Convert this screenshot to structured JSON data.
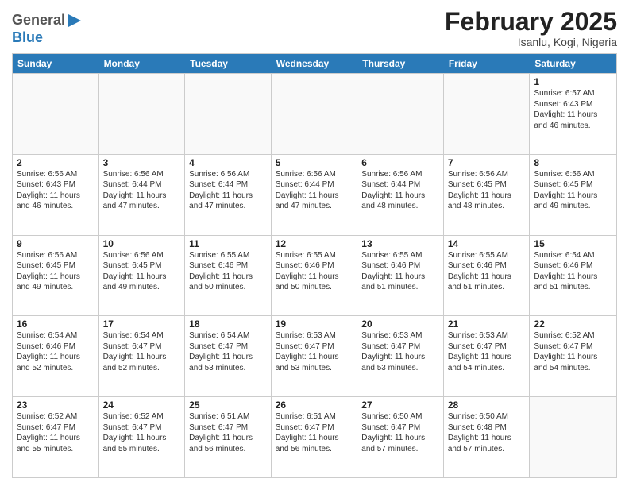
{
  "header": {
    "logo": {
      "line1": "General",
      "line2": "Blue",
      "icon": "▶"
    },
    "title": "February 2025",
    "location": "Isanlu, Kogi, Nigeria"
  },
  "weekdays": [
    "Sunday",
    "Monday",
    "Tuesday",
    "Wednesday",
    "Thursday",
    "Friday",
    "Saturday"
  ],
  "weeks": [
    [
      {
        "day": "",
        "empty": true
      },
      {
        "day": "",
        "empty": true
      },
      {
        "day": "",
        "empty": true
      },
      {
        "day": "",
        "empty": true
      },
      {
        "day": "",
        "empty": true
      },
      {
        "day": "",
        "empty": true
      },
      {
        "day": "1",
        "sunrise": "6:57 AM",
        "sunset": "6:43 PM",
        "daylight": "11 hours and 46 minutes."
      }
    ],
    [
      {
        "day": "2",
        "sunrise": "6:56 AM",
        "sunset": "6:43 PM",
        "daylight": "11 hours and 46 minutes."
      },
      {
        "day": "3",
        "sunrise": "6:56 AM",
        "sunset": "6:44 PM",
        "daylight": "11 hours and 47 minutes."
      },
      {
        "day": "4",
        "sunrise": "6:56 AM",
        "sunset": "6:44 PM",
        "daylight": "11 hours and 47 minutes."
      },
      {
        "day": "5",
        "sunrise": "6:56 AM",
        "sunset": "6:44 PM",
        "daylight": "11 hours and 47 minutes."
      },
      {
        "day": "6",
        "sunrise": "6:56 AM",
        "sunset": "6:44 PM",
        "daylight": "11 hours and 48 minutes."
      },
      {
        "day": "7",
        "sunrise": "6:56 AM",
        "sunset": "6:45 PM",
        "daylight": "11 hours and 48 minutes."
      },
      {
        "day": "8",
        "sunrise": "6:56 AM",
        "sunset": "6:45 PM",
        "daylight": "11 hours and 49 minutes."
      }
    ],
    [
      {
        "day": "9",
        "sunrise": "6:56 AM",
        "sunset": "6:45 PM",
        "daylight": "11 hours and 49 minutes."
      },
      {
        "day": "10",
        "sunrise": "6:56 AM",
        "sunset": "6:45 PM",
        "daylight": "11 hours and 49 minutes."
      },
      {
        "day": "11",
        "sunrise": "6:55 AM",
        "sunset": "6:46 PM",
        "daylight": "11 hours and 50 minutes."
      },
      {
        "day": "12",
        "sunrise": "6:55 AM",
        "sunset": "6:46 PM",
        "daylight": "11 hours and 50 minutes."
      },
      {
        "day": "13",
        "sunrise": "6:55 AM",
        "sunset": "6:46 PM",
        "daylight": "11 hours and 51 minutes."
      },
      {
        "day": "14",
        "sunrise": "6:55 AM",
        "sunset": "6:46 PM",
        "daylight": "11 hours and 51 minutes."
      },
      {
        "day": "15",
        "sunrise": "6:54 AM",
        "sunset": "6:46 PM",
        "daylight": "11 hours and 51 minutes."
      }
    ],
    [
      {
        "day": "16",
        "sunrise": "6:54 AM",
        "sunset": "6:46 PM",
        "daylight": "11 hours and 52 minutes."
      },
      {
        "day": "17",
        "sunrise": "6:54 AM",
        "sunset": "6:47 PM",
        "daylight": "11 hours and 52 minutes."
      },
      {
        "day": "18",
        "sunrise": "6:54 AM",
        "sunset": "6:47 PM",
        "daylight": "11 hours and 53 minutes."
      },
      {
        "day": "19",
        "sunrise": "6:53 AM",
        "sunset": "6:47 PM",
        "daylight": "11 hours and 53 minutes."
      },
      {
        "day": "20",
        "sunrise": "6:53 AM",
        "sunset": "6:47 PM",
        "daylight": "11 hours and 53 minutes."
      },
      {
        "day": "21",
        "sunrise": "6:53 AM",
        "sunset": "6:47 PM",
        "daylight": "11 hours and 54 minutes."
      },
      {
        "day": "22",
        "sunrise": "6:52 AM",
        "sunset": "6:47 PM",
        "daylight": "11 hours and 54 minutes."
      }
    ],
    [
      {
        "day": "23",
        "sunrise": "6:52 AM",
        "sunset": "6:47 PM",
        "daylight": "11 hours and 55 minutes."
      },
      {
        "day": "24",
        "sunrise": "6:52 AM",
        "sunset": "6:47 PM",
        "daylight": "11 hours and 55 minutes."
      },
      {
        "day": "25",
        "sunrise": "6:51 AM",
        "sunset": "6:47 PM",
        "daylight": "11 hours and 56 minutes."
      },
      {
        "day": "26",
        "sunrise": "6:51 AM",
        "sunset": "6:47 PM",
        "daylight": "11 hours and 56 minutes."
      },
      {
        "day": "27",
        "sunrise": "6:50 AM",
        "sunset": "6:47 PM",
        "daylight": "11 hours and 57 minutes."
      },
      {
        "day": "28",
        "sunrise": "6:50 AM",
        "sunset": "6:48 PM",
        "daylight": "11 hours and 57 minutes."
      },
      {
        "day": "",
        "empty": true
      }
    ]
  ]
}
